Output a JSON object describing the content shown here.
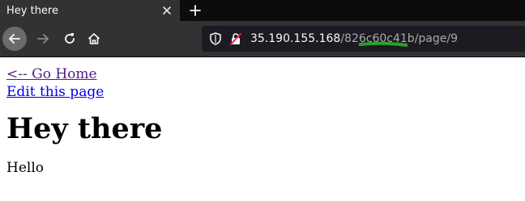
{
  "tab": {
    "title": "Hey there",
    "close_icon": "close-icon",
    "new_tab_icon": "plus-icon"
  },
  "nav": {
    "back_icon": "arrow-left-icon",
    "forward_icon": "arrow-right-icon",
    "reload_icon": "reload-icon",
    "home_icon": "home-icon"
  },
  "url": {
    "shield_icon": "shield-icon",
    "lock_icon": "insecure-lock-icon",
    "host": "35.190.155.168",
    "path": "/826c60c41b/page/9",
    "highlight_color": "#2ca02c"
  },
  "page": {
    "home_link": "<-- Go Home",
    "edit_link": "Edit this page",
    "heading": "Hey there",
    "body": "Hello"
  }
}
